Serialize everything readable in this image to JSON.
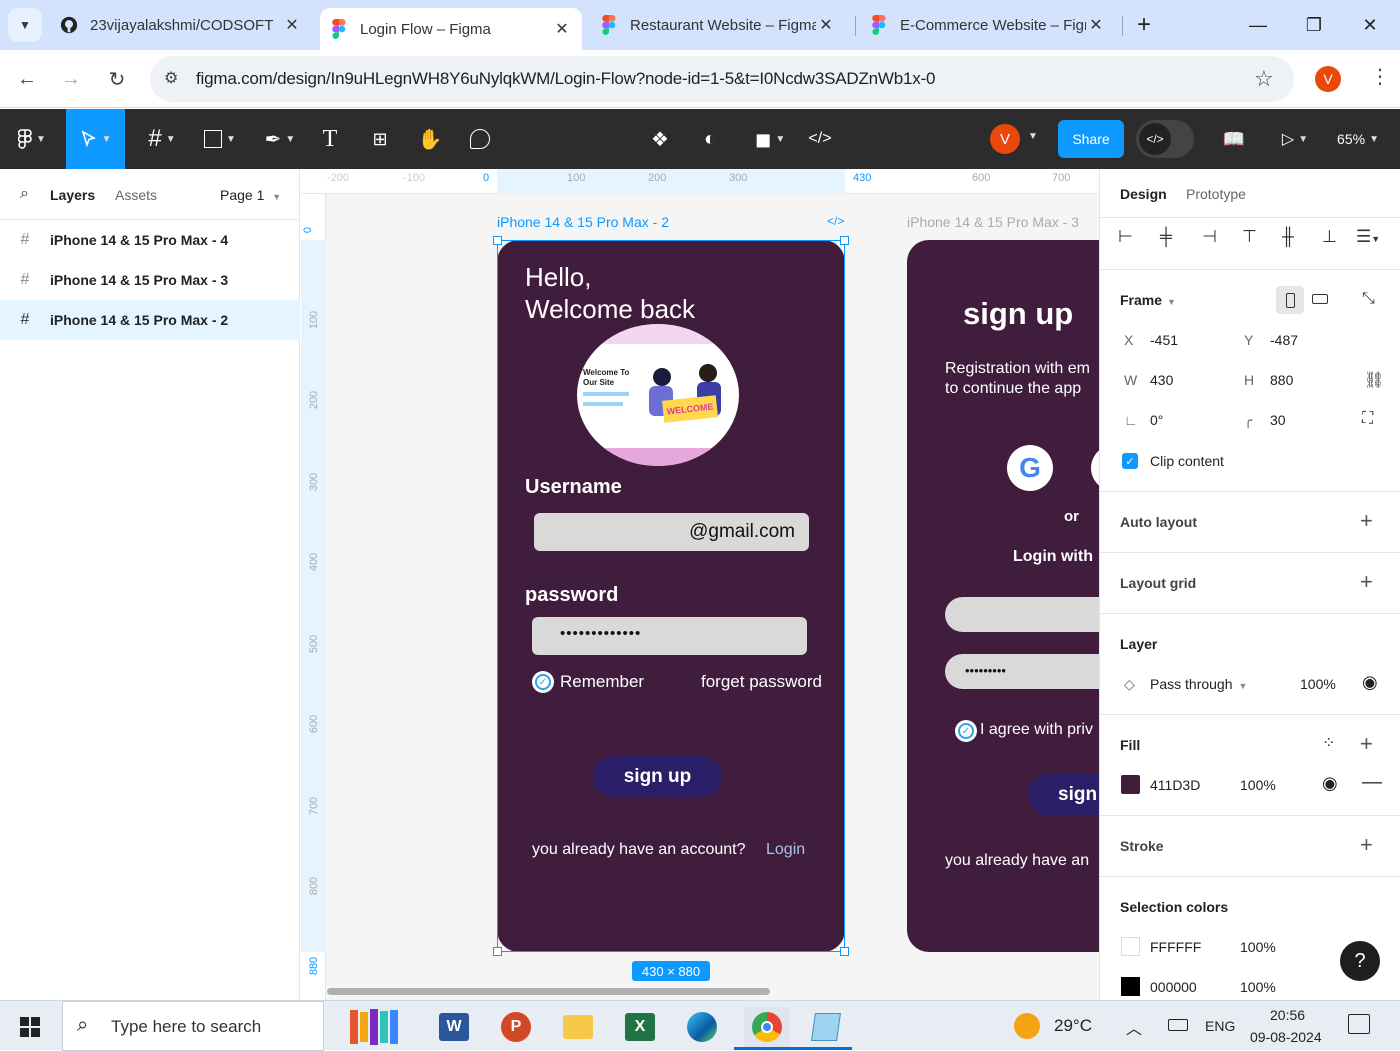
{
  "browser": {
    "tabs": [
      {
        "title": "23vijayalakshmi/CODSOFT",
        "icon": "github-icon",
        "active": false
      },
      {
        "title": "Login Flow – Figma",
        "icon": "figma-icon",
        "active": true
      },
      {
        "title": "Restaurant Website – Figma",
        "icon": "figma-icon",
        "active": false
      },
      {
        "title": "E-Commerce Website – Figma",
        "icon": "figma-icon",
        "active": false
      }
    ],
    "url": "figma.com/design/In9uHLegnWH8Y6uNylqkWM/Login-Flow?node-id=1-5&t=I0Ncdw3SADZnWb1x-0",
    "profile_initial": "V"
  },
  "toolbar": {
    "avatar_initial": "V",
    "share_label": "Share",
    "zoom": "65%"
  },
  "left_panel": {
    "tab_layers": "Layers",
    "tab_assets": "Assets",
    "page": "Page 1",
    "layers": [
      {
        "name": "iPhone 14 & 15 Pro Max - 4",
        "selected": false
      },
      {
        "name": "iPhone 14 & 15 Pro Max - 3",
        "selected": false
      },
      {
        "name": "iPhone 14 & 15 Pro Max - 2",
        "selected": true
      }
    ]
  },
  "canvas": {
    "ruler_top": [
      "-200",
      "-100",
      "0",
      "100",
      "200",
      "300",
      "430",
      "600",
      "700"
    ],
    "ruler_left": [
      "0",
      "100",
      "200",
      "300",
      "400",
      "500",
      "600",
      "700",
      "800",
      "880"
    ],
    "frame2": {
      "label": "iPhone 14 & 15 Pro Max - 2",
      "greeting_line1": "Hello,",
      "greeting_line2": "Welcome back",
      "illustration_title": "Welcome To Our Site",
      "illustration_banner": "WELCOME",
      "username_label": "Username",
      "username_value": "@gmail.com",
      "password_label": "password",
      "password_value": "•••••••••••••",
      "remember": "Remember",
      "forget": "forget password",
      "signup_button": "sign up",
      "account_text": "you already have an account?",
      "login_link": "Login",
      "size_badge": "430 × 880"
    },
    "frame3": {
      "label": "iPhone 14 & 15 Pro Max - 3",
      "title": "sign up",
      "reg_line1": "Registration with em",
      "reg_line2": "to continue the app",
      "or": "or",
      "login_with": "Login with",
      "password_value": "•••••••••",
      "agree": "I agree with priv",
      "signup_button": "sign",
      "account_text": "you already have an"
    }
  },
  "right_panel": {
    "tab_design": "Design",
    "tab_prototype": "Prototype",
    "frame_label": "Frame",
    "x_label": "X",
    "x": "-451",
    "y_label": "Y",
    "y": "-487",
    "w_label": "W",
    "w": "430",
    "h_label": "H",
    "h": "880",
    "rotation": "0°",
    "radius": "30",
    "clip_content": "Clip content",
    "auto_layout": "Auto layout",
    "layout_grid": "Layout grid",
    "layer_label": "Layer",
    "blend": "Pass through",
    "layer_opacity": "100%",
    "fill_label": "Fill",
    "fill_hex": "411D3D",
    "fill_opacity": "100%",
    "fill_color": "#411d3d",
    "stroke_label": "Stroke",
    "selection_colors_label": "Selection colors",
    "selection_colors": [
      {
        "hex": "FFFFFF",
        "opacity": "100%",
        "color": "#ffffff"
      },
      {
        "hex": "000000",
        "opacity": "100%",
        "color": "#000000"
      }
    ]
  },
  "taskbar": {
    "search_placeholder": "Type here to search",
    "weather": "29°C",
    "lang": "ENG",
    "time": "20:56",
    "date": "09-08-2024"
  }
}
